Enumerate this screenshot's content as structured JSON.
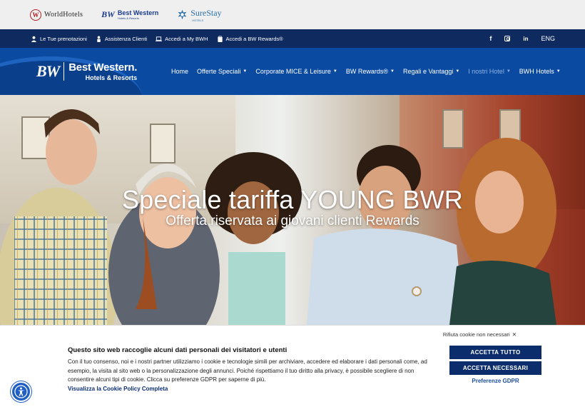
{
  "brand_bar": {
    "worldhotels": {
      "mark": "W",
      "label": "WorldHotels"
    },
    "bestwestern": {
      "mark": "BW",
      "name": "Best Western",
      "tag": "Hotels & Resorts"
    },
    "surestay": {
      "name": "SureStay",
      "tag": "HOTELS"
    }
  },
  "utility_bar": {
    "links": [
      {
        "label": "Le Tue prenotazioni",
        "icon": "user-icon"
      },
      {
        "label": "Assistenza Clienti",
        "icon": "person-icon"
      },
      {
        "label": "Accedi a My BWH",
        "icon": "laptop-icon"
      },
      {
        "label": "Accedi a BW Rewards®",
        "icon": "clipboard-icon"
      }
    ],
    "social": {
      "facebook": "f",
      "linkedin": "in"
    },
    "language": "ENG"
  },
  "nav": {
    "logo": {
      "mark": "BW",
      "name": "Best Western.",
      "tag": "Hotels & Resorts"
    },
    "items": [
      {
        "label": "Home",
        "chevron": false
      },
      {
        "label": "Offerte Speciali",
        "chevron": true
      },
      {
        "label": "Corporate MICE & Leisure",
        "chevron": true
      },
      {
        "label": "BW Rewards®",
        "chevron": true
      },
      {
        "label": "Regali e Vantaggi",
        "chevron": true
      },
      {
        "label": "I nostri Hotel",
        "chevron": true,
        "active": true
      },
      {
        "label": "BWH Hotels",
        "chevron": true
      }
    ]
  },
  "hero": {
    "title": "Speciale tariffa YOUNG BWR",
    "subtitle": "Offerta riservata ai giovani clienti Rewards"
  },
  "cookie": {
    "reject": "Rifiuta cookie non necessari",
    "title": "Questo sito web raccoglie alcuni dati personali dei visitatori e utenti",
    "body": "Con il tuo consenso, noi e i nostri partner utilizziamo i cookie e tecnologie simili per archiviare, accedere ed elaborare i dati personali come, ad esempio, la visita al sito web o la personalizzazione degli annunci. Poiché rispettiamo il tuo diritto alla privacy, è possibile scegliere di non consentire alcuni tipi di cookie. Clicca su preferenze GDPR per saperne di più.",
    "policy_link": "Visualizza la Cookie Policy Completa",
    "accept_all": "ACCETTA TUTTO",
    "accept_necessary": "ACCETTA NECESSARI",
    "preferences": "Preferenze GDPR"
  },
  "colors": {
    "brand_navy": "#0e2a5e",
    "nav_blue": "#0a4aa0",
    "button_navy": "#0b2d6b",
    "active_nav": "#8fb3e6"
  }
}
